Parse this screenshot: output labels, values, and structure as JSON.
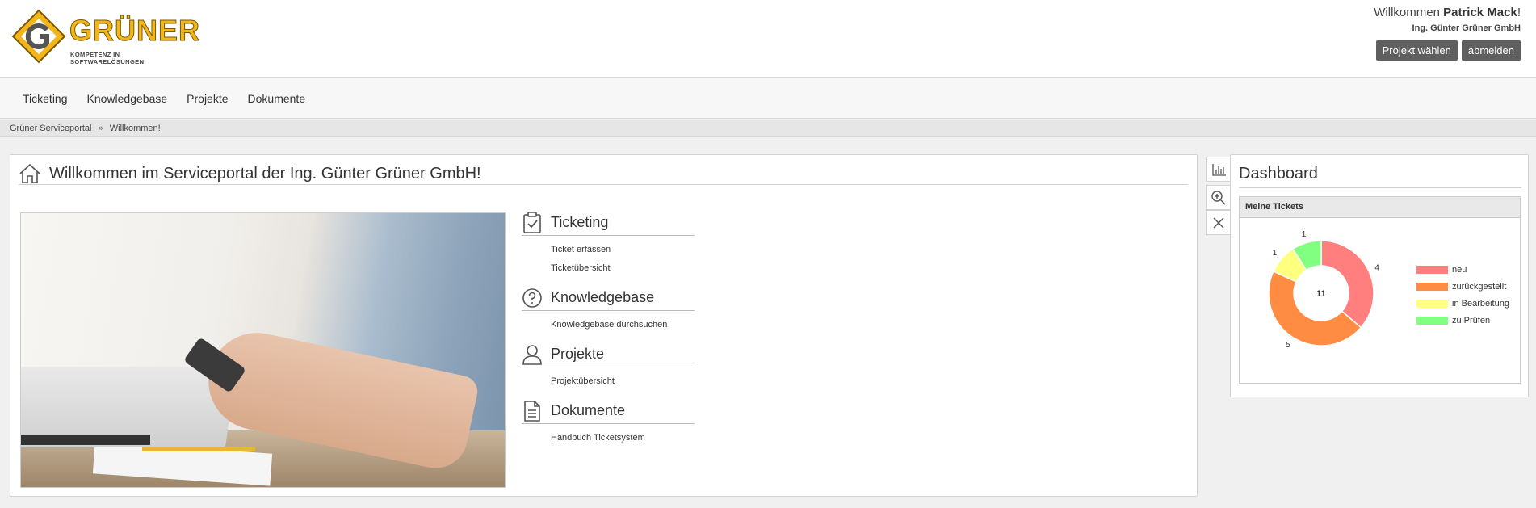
{
  "header": {
    "logo": {
      "brand": "GRÜNER",
      "tagline": "KOMPETENZ IN SOFTWARELÖSUNGEN"
    },
    "welcome_prefix": "Willkommen ",
    "user_name": "Patrick Mack",
    "welcome_suffix": "!",
    "company": "Ing. Günter Grüner GmbH",
    "btn_select_project": "Projekt wählen",
    "btn_logout": "abmelden"
  },
  "nav": {
    "items": [
      "Ticketing",
      "Knowledgebase",
      "Projekte",
      "Dokumente"
    ]
  },
  "breadcrumb": {
    "items": [
      "Grüner Serviceportal",
      "Willkommen!"
    ],
    "separator": "»"
  },
  "main": {
    "title": "Willkommen im Serviceportal der Ing. Günter Grüner GmbH!",
    "sections": [
      {
        "icon": "clipboard-check-icon",
        "title": "Ticketing",
        "links": [
          "Ticket erfassen",
          "Ticketübersicht"
        ]
      },
      {
        "icon": "question-circle-icon",
        "title": "Knowledgebase",
        "links": [
          "Knowledgebase durchsuchen"
        ]
      },
      {
        "icon": "user-icon",
        "title": "Projekte",
        "links": [
          "Projektübersicht"
        ]
      },
      {
        "icon": "document-icon",
        "title": "Dokumente",
        "links": [
          "Handbuch Ticketsystem"
        ]
      }
    ]
  },
  "side_tabs": [
    "bar-chart-icon",
    "zoom-in-icon",
    "close-icon"
  ],
  "dashboard": {
    "title": "Dashboard",
    "box_title": "Meine Tickets",
    "colors": {
      "neu": "#ff7f7f",
      "zurueckgestellt": "#ff8c42",
      "in_bearbeitung": "#ffff80",
      "zu_pruefen": "#80ff80"
    }
  },
  "chart_data": {
    "type": "pie",
    "donut": true,
    "center_label": "11",
    "categories": [
      "neu",
      "zurückgestellt",
      "in Bearbeitung",
      "zu Prüfen"
    ],
    "values": [
      4,
      5,
      1,
      1
    ],
    "colors": [
      "#ff7f7f",
      "#ff8c42",
      "#ffff80",
      "#80ff80"
    ],
    "legend_position": "right"
  }
}
